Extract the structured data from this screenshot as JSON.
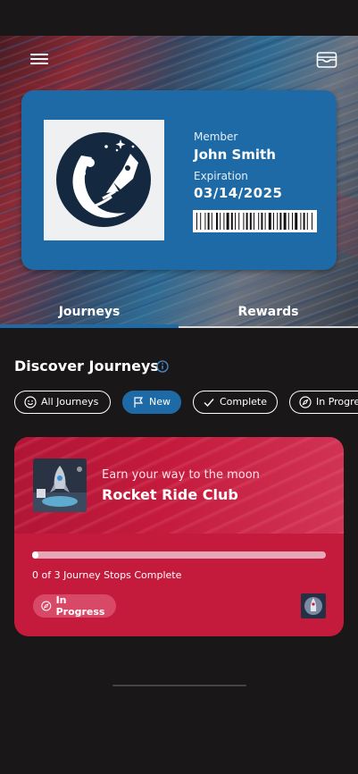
{
  "header": {
    "menu_icon": "hamburger-icon",
    "wallet_icon": "wallet-icon"
  },
  "card": {
    "member_label": "Member",
    "member_name": "John Smith",
    "expiration_label": "Expiration",
    "expiration_value": "03/14/2025",
    "logo": "rocket-moon-logo",
    "barcode_icon": "barcode-icon",
    "background_color": "#1e6aa6"
  },
  "tabs": [
    {
      "label": "Journeys",
      "active": true
    },
    {
      "label": "Rewards",
      "active": false
    }
  ],
  "discover": {
    "title": "Discover Journeys",
    "info_icon": "info-icon"
  },
  "filters": [
    {
      "label": "All Journeys",
      "icon": "smiley-icon",
      "selected": false
    },
    {
      "label": "New",
      "icon": "flag-icon",
      "selected": true
    },
    {
      "label": "Complete",
      "icon": "check-icon",
      "selected": false
    },
    {
      "label": "In Progress",
      "icon": "compass-icon",
      "selected": false
    }
  ],
  "journey": {
    "subtitle": "Earn your way to the moon",
    "title": "Rocket Ride Club",
    "progress_fraction": 0.02,
    "progress_text": "0 of 3 Journey Stops Complete",
    "status": "In Progress",
    "status_icon": "compass-icon",
    "card_color": "#c41a3c"
  },
  "colors": {
    "accent": "#1e6aa6",
    "background": "#1a1718"
  }
}
